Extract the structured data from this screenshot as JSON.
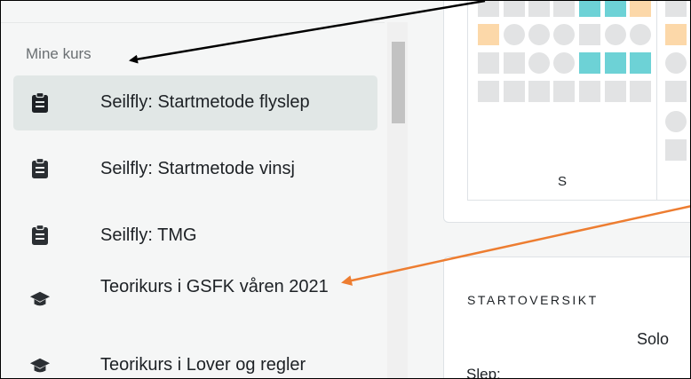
{
  "sidebar": {
    "section_label": "Mine kurs",
    "items": [
      {
        "label": "Seilfly: Startmetode flyslep",
        "icon": "clipboard-icon",
        "active": true
      },
      {
        "label": "Seilfly: Startmetode vinsj",
        "icon": "clipboard-icon",
        "active": false
      },
      {
        "label": "Seilfly: TMG",
        "icon": "clipboard-icon",
        "active": false
      },
      {
        "label": "Teorikurs i GSFK våren 2021",
        "icon": "graduation-cap-icon",
        "active": false
      },
      {
        "label": "Teorikurs i Lover og regler",
        "icon": "graduation-cap-icon",
        "active": false
      }
    ]
  },
  "activity_grid": {
    "column_label": "S",
    "colors": {
      "empty": "#e2e3e4",
      "teal": "#6dd2d6",
      "orange": "#fcd8a9"
    }
  },
  "start_overview": {
    "title": "STARTOVERSIKT",
    "column_header": "Solo",
    "row_label": "Slep:"
  },
  "annotations": {
    "arrow_black_color": "#000000",
    "arrow_orange_color": "#ed7d31"
  }
}
